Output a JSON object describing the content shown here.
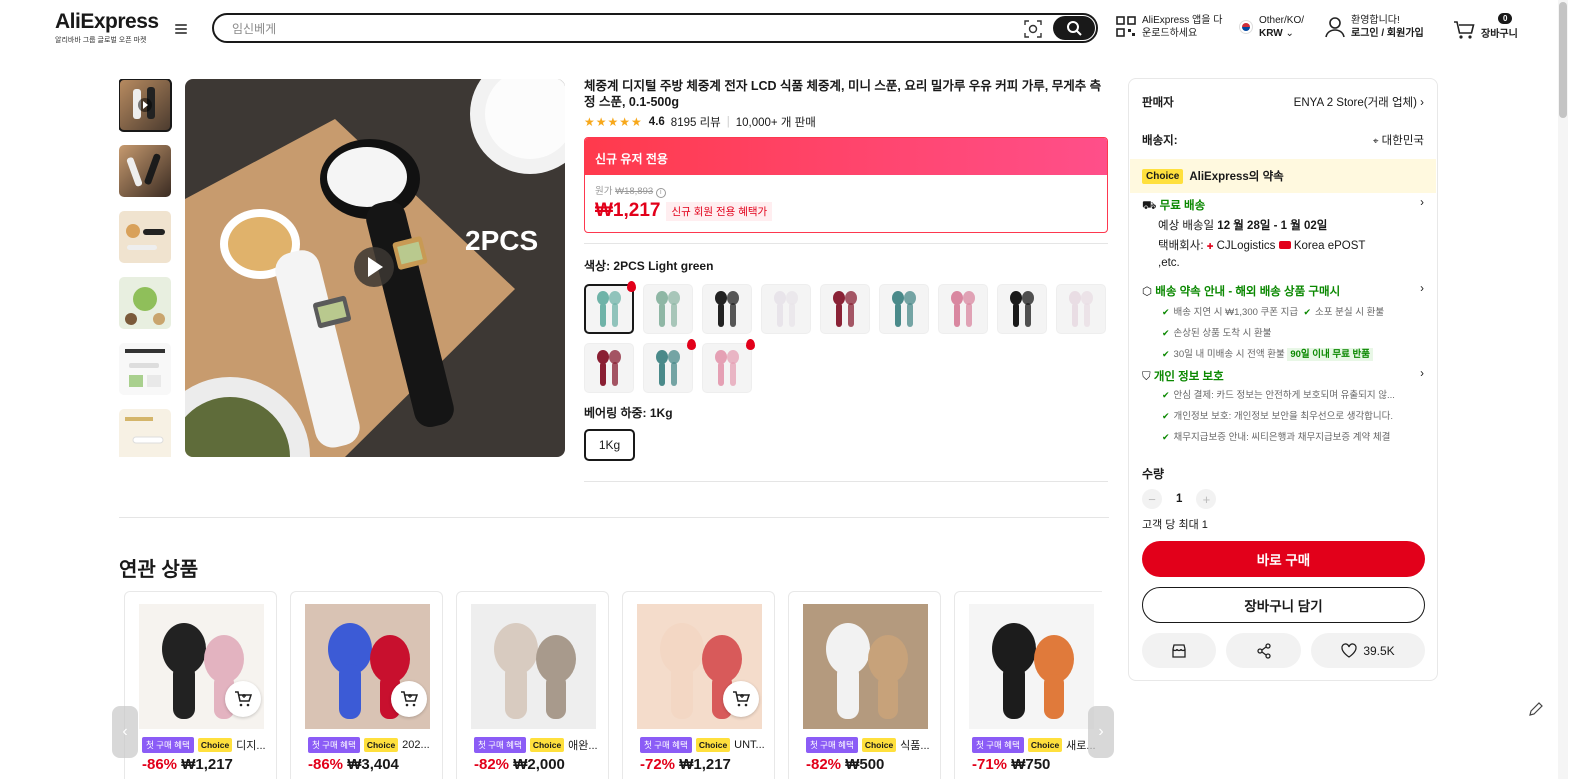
{
  "header": {
    "logo": "AliExpress",
    "logo_sub": "알리바바 그룹 글로벌 오픈 마켓",
    "search_placeholder": "임신베게",
    "app_line1": "AliExpress 앱을 다",
    "app_line2": "운로드하세요",
    "region_line1": "Other/KO/",
    "region_line2": "KRW",
    "account_line1": "환영합니다!",
    "account_line2": "로그인 / 회원가입",
    "cart_count": "0",
    "cart_label": "장바구니"
  },
  "product": {
    "title": "체중계 디지털 주방 체중계 전자 LCD 식품 체중계, 미니 스푼, 요리 밀가루 우유 커피 가루, 무게추 측정 스푼, 0.1-500g",
    "rating": "4.6",
    "reviews": "8195 리뷰",
    "sold": "10,000+ 개 판매",
    "promo_header": "신규 유저 전용",
    "orig_label": "원가",
    "orig_price": "₩18,893",
    "price": "₩1,217",
    "price_tag": "신규 회원 전용 혜택가",
    "color_label": "색상: 2PCS Light green",
    "weight_label": "베어링 하중: 1Kg",
    "size_option": "1Kg",
    "image_caption": "2PCS",
    "swatch_colors": [
      "#6fb3a8",
      "#8fb7a5",
      "#222222",
      "#e8e4ea",
      "#8a2236",
      "#4a8a8a",
      "#d987a0",
      "#1a1a1a",
      "#e9dde4",
      "#8a1f33",
      "#4a8a8a",
      "#e5a0b4"
    ],
    "swatch_fire": [
      0,
      10,
      11
    ]
  },
  "panel": {
    "seller_label": "판매자",
    "seller_value": "ENYA 2 Store(거래 업체)",
    "ship_label": "배송지:",
    "ship_value": "대한민국",
    "choice_badge": "Choice",
    "choice_text": "AliExpress의 약속",
    "free_ship": "무료 배송",
    "delivery_prefix": "예상 배송일 ",
    "delivery_dates": "12 월 28일 - 1 월 02일",
    "carrier_label": "택배회사:",
    "carrier_1": "CJLogistics",
    "carrier_2": "Korea",
    "carrier_3": "ePOST ,etc.",
    "promise_title": "배송 약속 안내 - 해외 배송 상품 구매시",
    "promise_1": "배송 지연 시 ₩1,300 쿠폰 지급",
    "promise_2": "소포 분실 시 환불",
    "promise_3": "손상된 상품 도착 시 환불",
    "promise_4": "30일 내 미배송 시 전액 환불",
    "promise_4_badge": "90일 이내 무료 반품",
    "privacy_title": "개인 정보 보호",
    "privacy_1": "안심 결제: 카드 정보는 안전하게 보호되며 유출되지 않...",
    "privacy_2": "개인정보 보호: 개인정보 보안을 최우선으로 생각합니다.",
    "privacy_3": "채무지급보증 안내: 씨티은행과 채무지급보증 계약 체결",
    "qty_label": "수량",
    "qty_value": "1",
    "qty_limit": "고객 당 최대 1",
    "buy_now": "바로 구매",
    "add_cart": "장바구니 담기",
    "wishlist_count": "39.5K"
  },
  "related": {
    "title": "연관 상품",
    "badge_first": "첫 구매 혜택",
    "badge_choice": "Choice",
    "items": [
      {
        "name": "디지...",
        "discount": "-86%",
        "price": "₩1,217",
        "c1": "#222",
        "c2": "#e3b3c0",
        "bg": "#f6f3ef"
      },
      {
        "name": "202...",
        "discount": "-86%",
        "price": "₩3,404",
        "c1": "#3c5bd6",
        "c2": "#c8102e",
        "bg": "#d9c3b4"
      },
      {
        "name": "애완...",
        "discount": "-82%",
        "price": "₩2,000",
        "c1": "#d8cbc0",
        "c2": "#a89a8c",
        "bg": "#eeeeee"
      },
      {
        "name": "UNT...",
        "discount": "-72%",
        "price": "₩1,217",
        "c1": "#f3d7c4",
        "c2": "#d85a5a",
        "bg": "#f4dccb"
      },
      {
        "name": "식품...",
        "discount": "-82%",
        "price": "₩500",
        "c1": "#f2f2f2",
        "c2": "#c7a27a",
        "bg": "#b49a7e"
      },
      {
        "name": "새로...",
        "discount": "-71%",
        "price": "₩750",
        "c1": "#1c1c1c",
        "c2": "#e07a3b",
        "bg": "#f5f5f5"
      }
    ]
  }
}
